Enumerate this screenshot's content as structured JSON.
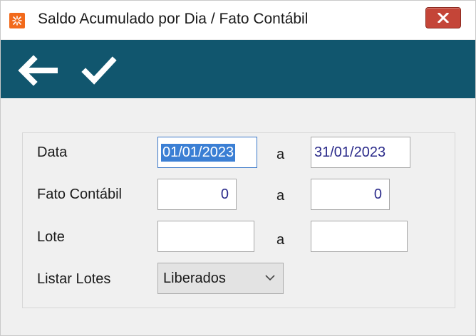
{
  "window": {
    "title": "Saldo Acumulado por Dia / Fato Contábil",
    "close_icon": "close-icon",
    "app_icon": "app-logo-icon"
  },
  "toolbar": {
    "back_icon": "back-arrow-icon",
    "confirm_icon": "checkmark-icon",
    "background": "#11566e"
  },
  "form": {
    "separator": "a",
    "data": {
      "label": "Data",
      "from": "01/01/2023",
      "to": "31/01/2023"
    },
    "fato": {
      "label": "Fato Contábil",
      "from": "0",
      "to": "0"
    },
    "lote": {
      "label": "Lote",
      "from": "",
      "to": ""
    },
    "listar": {
      "label": "Listar Lotes",
      "selected": "Liberados"
    }
  },
  "colors": {
    "close_button": "#c44538",
    "selection": "#3b7fd4",
    "value_text": "#2a2a8a"
  }
}
